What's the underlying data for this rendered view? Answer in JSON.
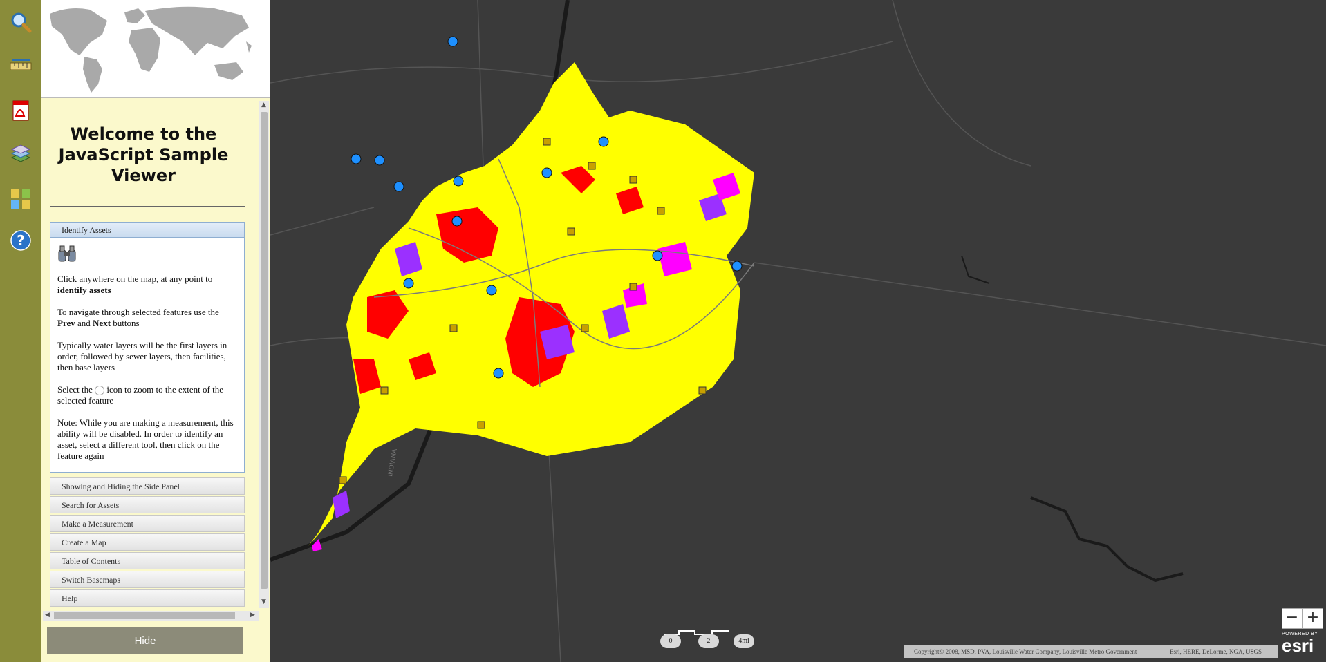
{
  "panel": {
    "welcome_title": "Welcome to the JavaScript Sample Viewer",
    "hide_label": "Hide"
  },
  "accordion": {
    "open_section": {
      "title": "Identify Assets",
      "p1_text": "Click anywhere on the map, at any point to",
      "p1_bold": "identify assets",
      "p2_a": "To navigate through selected features use the",
      "p2_prev": "Prev",
      "p2_and": "and",
      "p2_next": "Next",
      "p2_buttons": "buttons",
      "p3": "Typically water layers will be the first layers in order, followed by sewer layers, then facilities, then base layers",
      "p4_a": "Select the",
      "p4_b": "icon to zoom to the extent of the selected feature",
      "p5": "Note: While you are making a measurement, this ability will be disabled. In order to identify an asset, select a different tool, then click on the feature again"
    },
    "collapsed": [
      {
        "label": "Showing and Hiding the Side Panel"
      },
      {
        "label": "Search for Assets"
      },
      {
        "label": "Make a Measurement"
      },
      {
        "label": "Create a Map"
      },
      {
        "label": "Table of Contents"
      },
      {
        "label": "Switch Basemaps"
      },
      {
        "label": "Help"
      }
    ]
  },
  "toolbar": {
    "tools": [
      "search-icon",
      "measure-ruler-icon",
      "pdf-icon",
      "layers-icon",
      "basemaps-icon",
      "help-icon"
    ]
  },
  "map": {
    "zoom_out": "−",
    "zoom_in": "+",
    "scale_labels": [
      "0",
      "2",
      "4mi"
    ],
    "map_label": "INDIANA",
    "attribution_left": "Copyright© 2008, MSD, PVA, Louisville Water Company, Louisville Metro Government",
    "attribution_right": "Esri, HERE, DeLorme, NGA, USGS",
    "logo_powered": "POWERED BY",
    "logo_text": "esri",
    "colors": {
      "basemap": "#3a3a3a",
      "county_fill": "#ffff00",
      "red_zone": "#ff0000",
      "purple_zone": "#9b30ff",
      "magenta_zone": "#ff00ff",
      "toolbar": "#8a8c3a",
      "panel": "#fbf9cc"
    }
  }
}
